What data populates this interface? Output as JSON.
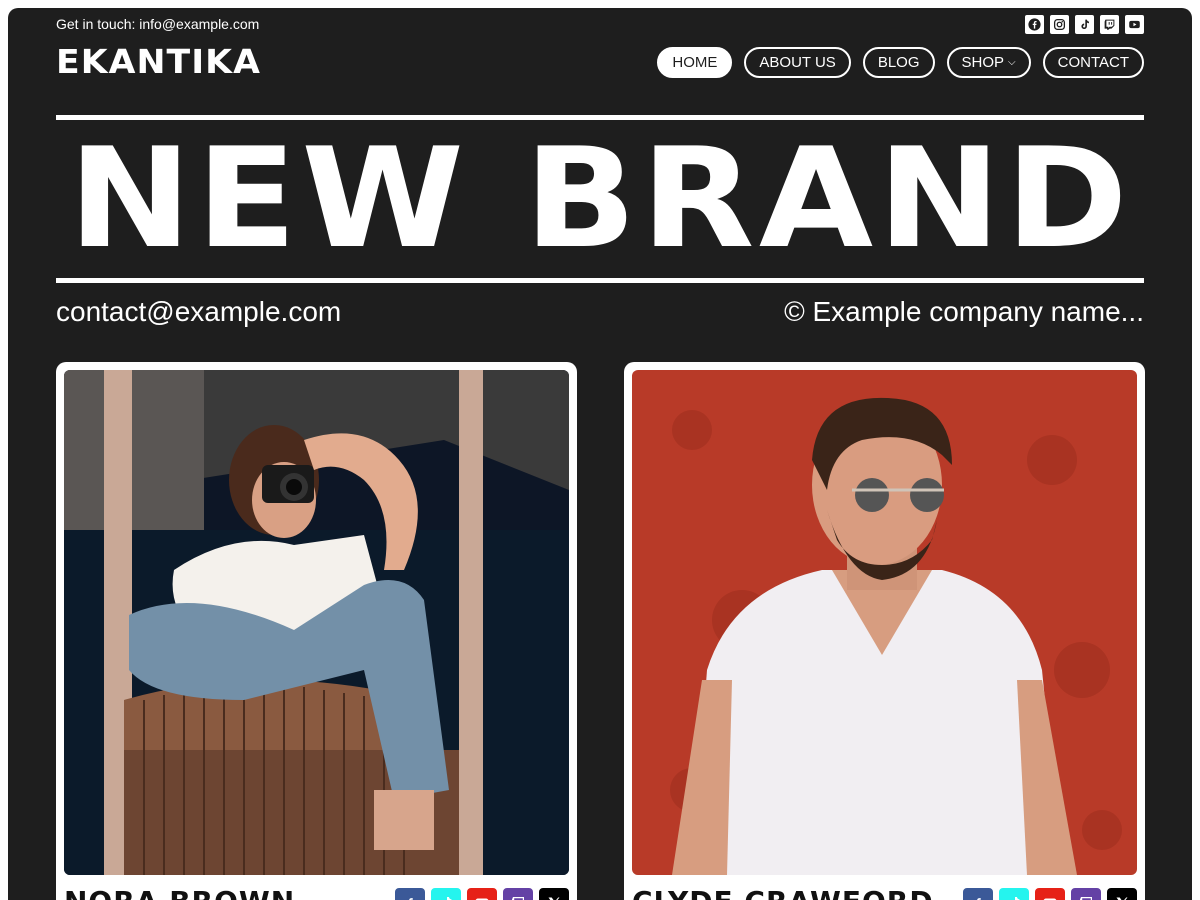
{
  "topbar": {
    "touch_text": "Get in touch: info@example.com"
  },
  "brand": {
    "logo": "EKANTIKA"
  },
  "nav": {
    "home": "HOME",
    "about": "ABOUT US",
    "blog": "BLOG",
    "shop": "SHOP",
    "contact": "CONTACT"
  },
  "hero": {
    "title": "NEW BRAND"
  },
  "contact_row": {
    "email": "contact@example.com",
    "copyright": "© Example company name..."
  },
  "cards": [
    {
      "name": "NORA BROWN"
    },
    {
      "name": "CLYDE CRAWFORD"
    }
  ],
  "social_icons": [
    "facebook-icon",
    "instagram-icon",
    "tiktok-icon",
    "twitch-icon",
    "youtube-icon"
  ],
  "card_social_icons": [
    "facebook-icon",
    "tiktok-icon",
    "youtube-icon",
    "twitch-icon",
    "x-icon"
  ],
  "colors": {
    "background": "#1e1e1e",
    "text": "#ffffff",
    "facebook": "#3b5998",
    "tiktok": "#25f4ee",
    "youtube": "#e62117",
    "twitch": "#6441a5",
    "x": "#000000"
  }
}
